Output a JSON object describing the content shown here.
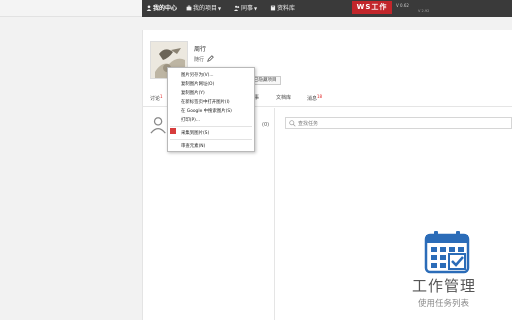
{
  "nav": {
    "items": [
      {
        "label": "我的中心",
        "active": true
      },
      {
        "label": "我的项目"
      },
      {
        "label": "同事"
      },
      {
        "label": "资料库"
      }
    ],
    "logo_text": "WS工作",
    "version": "V 0.62",
    "version2": "V 2.92"
  },
  "profile": {
    "name": "周行",
    "signature": "随行",
    "hidden_projects_label": "已隐藏项目"
  },
  "tabs": [
    {
      "label": "讨论",
      "badge": "1"
    },
    {
      "label": "事"
    },
    {
      "label": "文档库"
    },
    {
      "label": "消息",
      "badge": "18"
    }
  ],
  "left_count": "(0)",
  "search": {
    "placeholder": "查找任务"
  },
  "context_menu": {
    "items": [
      "图片另存为(V)...",
      "复制图片网址(O)",
      "复制图片(Y)",
      "在新标签页中打开图片(I)",
      "在 Google 中搜索图片(S)",
      "打印(P)...",
      "采集到图片(S)",
      "审查元素(N)"
    ]
  },
  "promo": {
    "title": "工作管理",
    "subtitle": "使用任务列表"
  },
  "colors": {
    "nav_bg": "#3a3a3a",
    "accent": "#c2262b",
    "icon_blue": "#2b6cb8"
  }
}
